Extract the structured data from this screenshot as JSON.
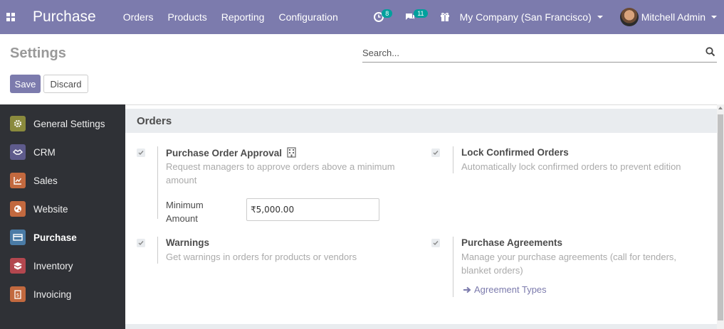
{
  "navbar": {
    "app_name": "Purchase",
    "menu": [
      "Orders",
      "Products",
      "Reporting",
      "Configuration"
    ],
    "activities_count": "8",
    "messages_count": "11",
    "company": "My Company (San Francisco)",
    "user": "Mitchell Admin",
    "icons": [
      "apps-grid-icon",
      "activity-clock-icon",
      "chat-icon",
      "gift-icon"
    ]
  },
  "control_panel": {
    "title": "Settings",
    "search_placeholder": "Search...",
    "save_label": "Save",
    "discard_label": "Discard"
  },
  "sidebar": {
    "items": [
      {
        "label": "General Settings",
        "icon": "gear-icon",
        "color": "#8a8a3d"
      },
      {
        "label": "CRM",
        "icon": "handshake-icon",
        "color": "#5e5b8c"
      },
      {
        "label": "Sales",
        "icon": "chart-icon",
        "color": "#c2693f"
      },
      {
        "label": "Website",
        "icon": "globe-icon",
        "color": "#c2693f"
      },
      {
        "label": "Purchase",
        "icon": "card-icon",
        "color": "#4a7ba6"
      },
      {
        "label": "Inventory",
        "icon": "box-icon",
        "color": "#b3474f"
      },
      {
        "label": "Invoicing",
        "icon": "invoice-icon",
        "color": "#c2693f"
      }
    ],
    "active": "Purchase"
  },
  "content": {
    "section_title": "Orders",
    "settings": {
      "po_approval": {
        "title": "Purchase Order Approval",
        "desc_line1": "Request managers to approve orders above a minimum",
        "desc_line2": "amount",
        "field_label_line1": "Minimum",
        "field_label_line2": "Amount",
        "field_value": "₹5,000.00",
        "checked": true
      },
      "lock_orders": {
        "title": "Lock Confirmed Orders",
        "desc": "Automatically lock confirmed orders to prevent edition",
        "checked": true
      },
      "warnings": {
        "title": "Warnings",
        "desc": "Get warnings in orders for products or vendors",
        "checked": true
      },
      "agreements": {
        "title": "Purchase Agreements",
        "desc_line1": "Manage your purchase agreements (call for tenders,",
        "desc_line2": "blanket orders)",
        "link": "Agreement Types",
        "checked": true
      }
    }
  }
}
